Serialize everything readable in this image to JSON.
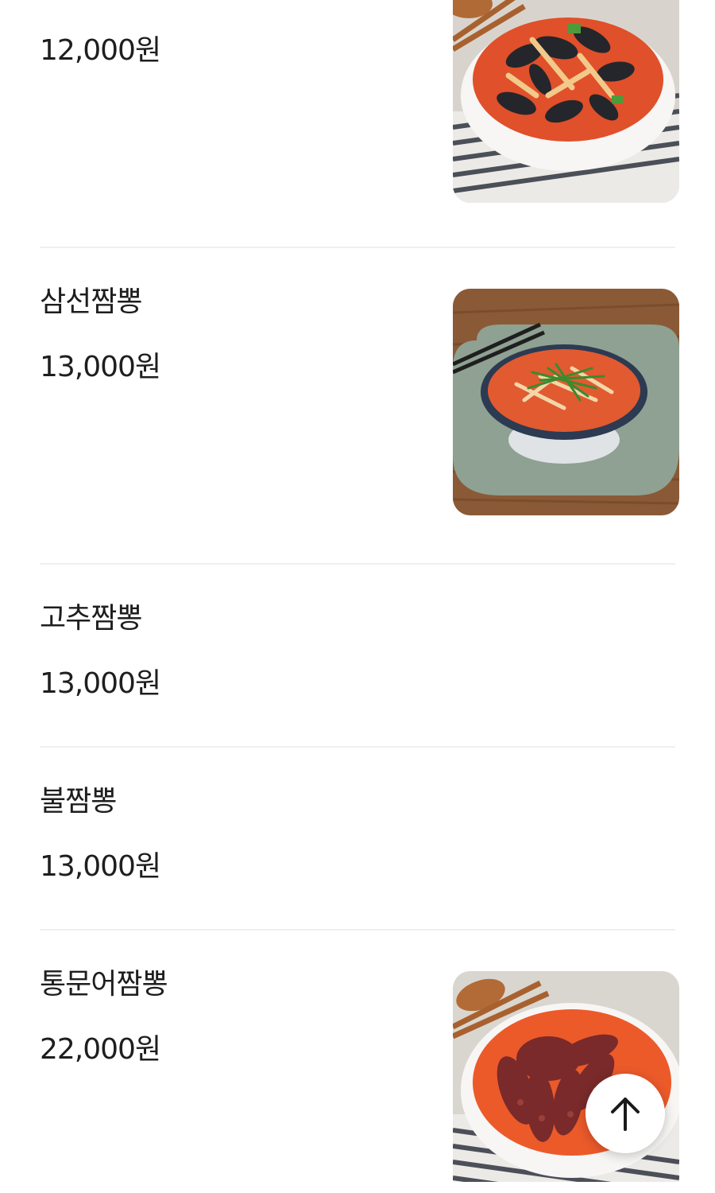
{
  "menu": {
    "items": [
      {
        "name": "",
        "price": "12,000원",
        "has_photo": true,
        "photo_icon": "mussel-jjamppong-photo"
      },
      {
        "name": "삼선짬뽕",
        "price": "13,000원",
        "has_photo": true,
        "photo_icon": "samseon-jjamppong-photo"
      },
      {
        "name": "고추짬뽕",
        "price": "13,000원",
        "has_photo": false
      },
      {
        "name": "불짬뽕",
        "price": "13,000원",
        "has_photo": false
      },
      {
        "name": "통문어짬뽕",
        "price": "22,000원",
        "has_photo": true,
        "photo_icon": "octopus-jjamppong-photo"
      }
    ]
  },
  "scroll_top": {
    "icon": "arrow-up-icon"
  },
  "colors": {
    "text": "#1e1e1e",
    "divider": "#efefef",
    "soup": "#e0502a",
    "background": "#ffffff"
  }
}
